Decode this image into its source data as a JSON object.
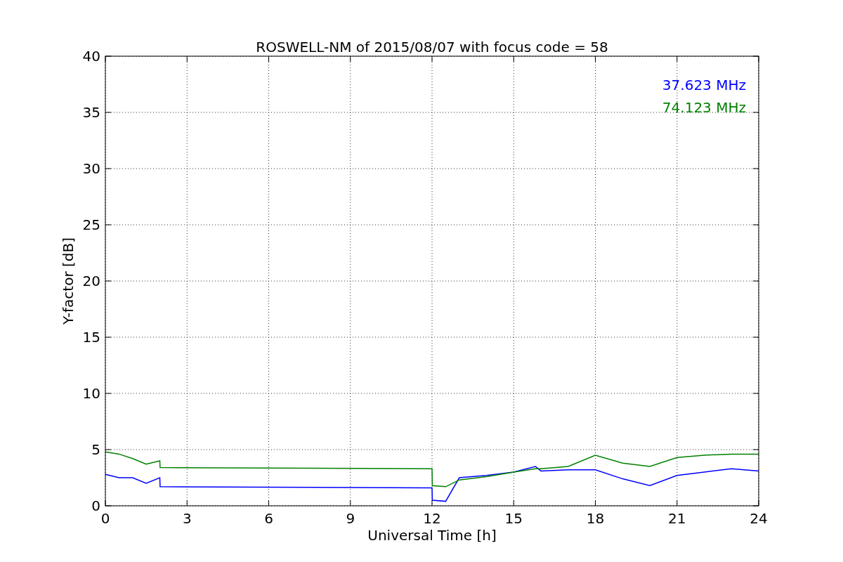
{
  "figure": {
    "chart_data": {
      "type": "line",
      "title": "ROSWELL-NM of 2015/08/07 with focus code = 58",
      "xlabel": "Universal Time [h]",
      "ylabel": "Y-factor [dB]",
      "x": [
        0,
        0.5,
        1,
        1.5,
        2,
        2.01,
        12,
        12.01,
        12.5,
        13,
        14,
        15,
        15.8,
        16,
        17,
        18,
        19,
        20,
        21,
        22,
        23,
        24
      ],
      "series": [
        {
          "name": "37.623 MHz",
          "color": "#0000ff",
          "values": [
            2.8,
            2.5,
            2.5,
            2,
            2.5,
            1.7,
            1.6,
            0.5,
            0.4,
            2.5,
            2.7,
            3,
            3.5,
            3.1,
            3.2,
            3.2,
            2.4,
            1.8,
            2.7,
            3,
            3.3,
            3.1
          ]
        },
        {
          "name": "74.123 MHz",
          "color": "#008000",
          "values": [
            4.8,
            4.6,
            4.2,
            3.7,
            4,
            3.4,
            3.3,
            1.8,
            1.7,
            2.3,
            2.6,
            3,
            3.3,
            3.3,
            3.5,
            4.5,
            3.8,
            3.5,
            4.3,
            4.5,
            4.6,
            4.6
          ]
        }
      ],
      "xlim": [
        0,
        24
      ],
      "ylim": [
        0,
        40
      ],
      "xticks": [
        0,
        3,
        6,
        9,
        12,
        15,
        18,
        21,
        24
      ],
      "yticks": [
        0,
        5,
        10,
        15,
        20,
        25,
        30,
        35,
        40
      ],
      "grid": true
    }
  }
}
